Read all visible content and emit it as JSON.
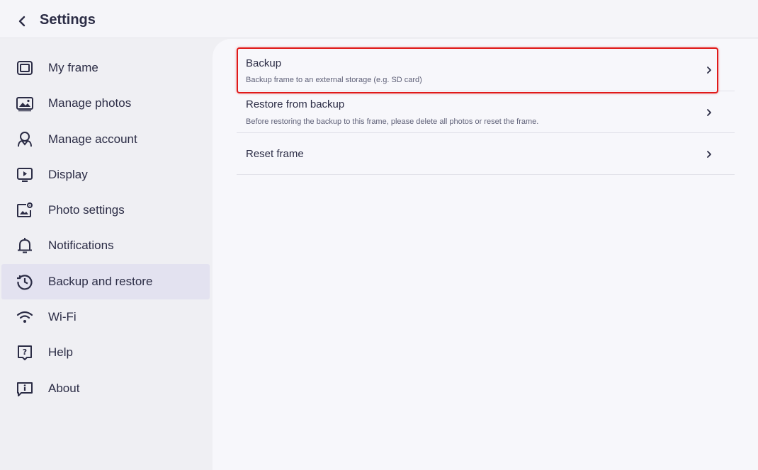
{
  "header": {
    "title": "Settings",
    "back_icon": "chevron-left-icon"
  },
  "sidebar": {
    "items": [
      {
        "label": "My frame",
        "icon": "frame-icon",
        "active": false
      },
      {
        "label": "Manage photos",
        "icon": "photos-icon",
        "active": false
      },
      {
        "label": "Manage account",
        "icon": "account-icon",
        "active": false
      },
      {
        "label": "Display",
        "icon": "display-icon",
        "active": false
      },
      {
        "label": "Photo settings",
        "icon": "photo-settings-icon",
        "active": false
      },
      {
        "label": "Notifications",
        "icon": "bell-icon",
        "active": false
      },
      {
        "label": "Backup and restore",
        "icon": "history-icon",
        "active": true
      },
      {
        "label": "Wi-Fi",
        "icon": "wifi-icon",
        "active": false
      },
      {
        "label": "Help",
        "icon": "help-icon",
        "active": false
      },
      {
        "label": "About",
        "icon": "info-icon",
        "active": false
      }
    ]
  },
  "main": {
    "rows": [
      {
        "title": "Backup",
        "subtitle": "Backup frame to an external storage (e.g. SD card)",
        "highlighted": true
      },
      {
        "title": "Restore from backup",
        "subtitle": "Before restoring the backup to this frame, please delete all photos or reset the frame.",
        "highlighted": false
      },
      {
        "title": "Reset frame",
        "subtitle": "",
        "highlighted": false
      }
    ]
  },
  "colors": {
    "text": "#2b2c45",
    "active_bg": "#e3e2f0",
    "highlight_border": "#e01919"
  }
}
